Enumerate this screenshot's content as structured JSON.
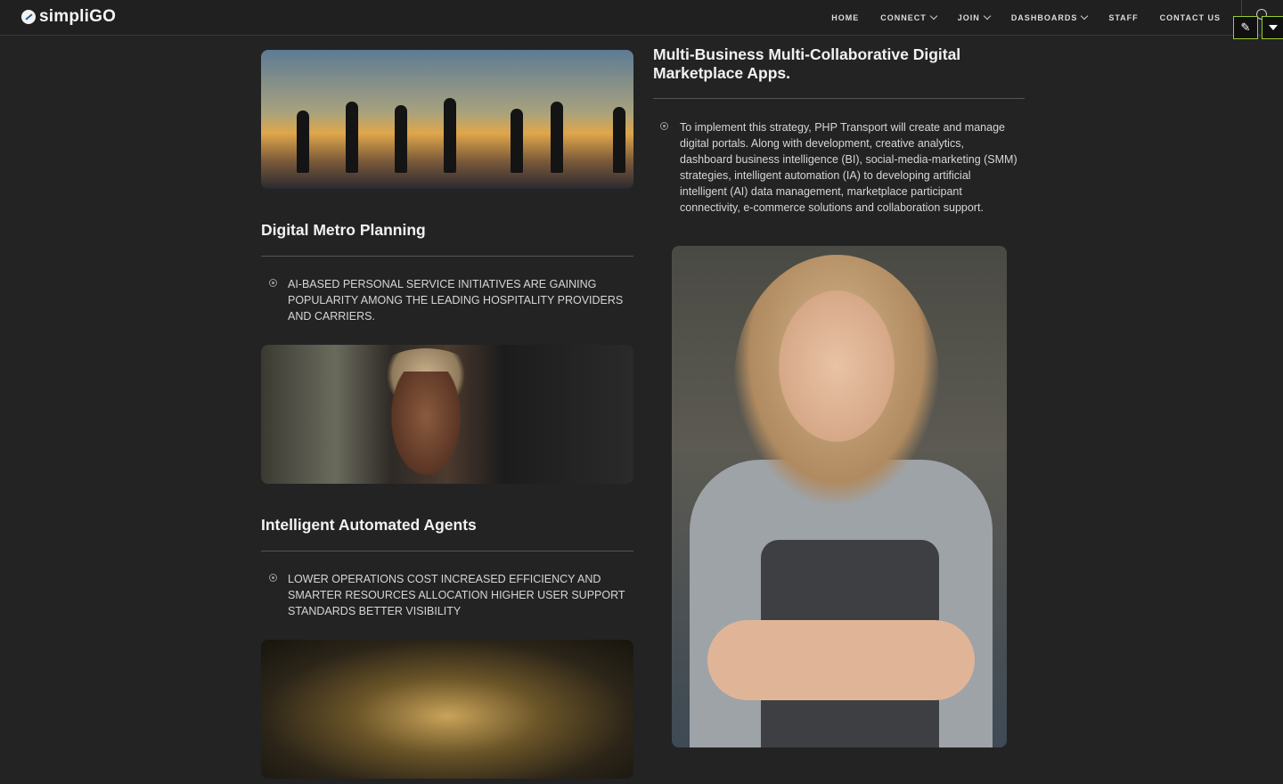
{
  "header": {
    "brand": "simpliGO",
    "nav": [
      {
        "label": "HOME",
        "dropdown": false
      },
      {
        "label": "CONNECT",
        "dropdown": true
      },
      {
        "label": "JOIN",
        "dropdown": true
      },
      {
        "label": "DASHBOARDS",
        "dropdown": true
      },
      {
        "label": "STAFF",
        "dropdown": false
      },
      {
        "label": "CONTACT US",
        "dropdown": false
      }
    ],
    "edit_icon": "edit-icon",
    "accent": "#9acd32"
  },
  "right": {
    "title": "Multi-Business Multi-Collaborative Digital Marketplace Apps.",
    "text": "To implement this strategy, PHP Transport will create and manage digital portals. Along with development, creative analytics, dashboard business intelligence (BI), social-media-marketing (SMM) strategies, intelligent automation (IA) to developing artificial intelligent (AI) data management, marketplace participant connectivity, e-commerce solutions and collaboration support."
  },
  "left": {
    "section1": {
      "title": "Digital Metro Planning",
      "text": "AI-BASED PERSONAL SERVICE INITIATIVES ARE GAINING POPULARITY AMONG THE LEADING HOSPITALITY PROVIDERS AND CARRIERS."
    },
    "section2": {
      "title": "Intelligent Automated Agents",
      "text": "LOWER OPERATIONS COST INCREASED EFFICIENCY AND SMARTER RESOURCES ALLOCATION HIGHER USER SUPPORT STANDARDS BETTER VISIBILITY"
    }
  }
}
